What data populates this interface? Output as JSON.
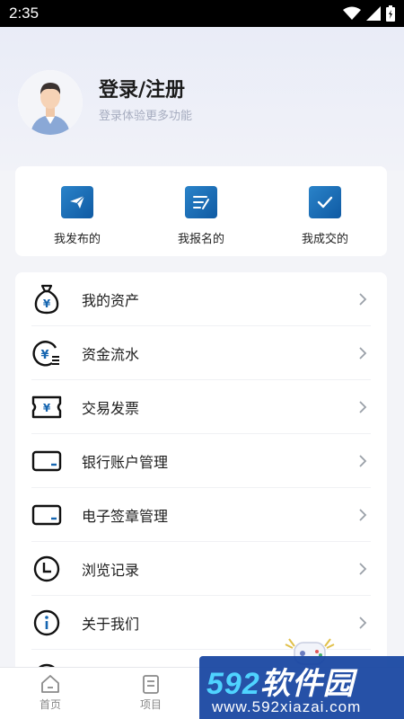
{
  "status_bar": {
    "time": "2:35"
  },
  "profile": {
    "title": "登录/注册",
    "subtitle": "登录体验更多功能"
  },
  "quick_actions": [
    {
      "label": "我发布的",
      "icon": "paper-plane-icon"
    },
    {
      "label": "我报名的",
      "icon": "edit-list-icon"
    },
    {
      "label": "我成交的",
      "icon": "checkbox-icon"
    }
  ],
  "menu": [
    {
      "label": "我的资产",
      "icon": "money-bag-icon"
    },
    {
      "label": "资金流水",
      "icon": "yuan-flow-icon"
    },
    {
      "label": "交易发票",
      "icon": "invoice-ticket-icon"
    },
    {
      "label": "银行账户管理",
      "icon": "bank-card-icon"
    },
    {
      "label": "电子签章管理",
      "icon": "e-seal-card-icon"
    },
    {
      "label": "浏览记录",
      "icon": "clock-icon"
    },
    {
      "label": "关于我们",
      "icon": "info-icon"
    }
  ],
  "tabs": [
    {
      "label": "首页",
      "icon": "home-icon"
    },
    {
      "label": "项目",
      "icon": "document-icon"
    }
  ],
  "watermark": {
    "brand_num": "592",
    "brand_text": "软件园",
    "url": "www.592xiazai.com"
  },
  "colors": {
    "accent": "#1565b0",
    "background": "#f3f4f8"
  }
}
